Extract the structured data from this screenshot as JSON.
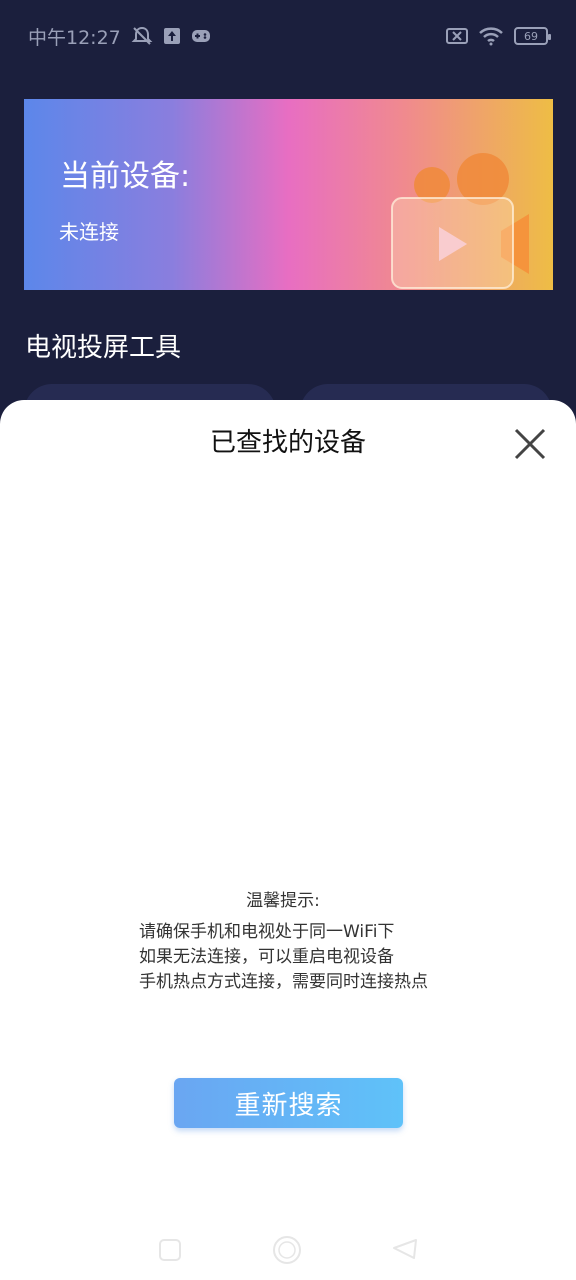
{
  "status_bar": {
    "time": "中午12:27",
    "battery_level": "69",
    "icons": [
      "mute-bell-icon",
      "upload-icon",
      "gamepad-icon",
      "sim-off-icon",
      "wifi-icon",
      "battery-icon"
    ]
  },
  "device_card": {
    "title": "当前设备:",
    "status": "未连接"
  },
  "section": {
    "title": "电视投屏工具"
  },
  "sheet": {
    "title": "已查找的设备",
    "close_icon": "close-icon",
    "tips_heading": "温馨提示:",
    "tips": [
      "请确保手机和电视处于同一WiFi下",
      "如果无法连接，可以重启电视设备",
      "手机热点方式连接，需要同时连接热点"
    ],
    "research_button": "重新搜索"
  },
  "nav_bar": {
    "buttons": [
      "recent-apps-icon",
      "home-icon",
      "back-icon"
    ]
  },
  "colors": {
    "background": "#1b1f3d",
    "sheet": "#ffffff",
    "button_gradient_start": "#6aa6f2",
    "button_gradient_end": "#5fc2f9"
  }
}
